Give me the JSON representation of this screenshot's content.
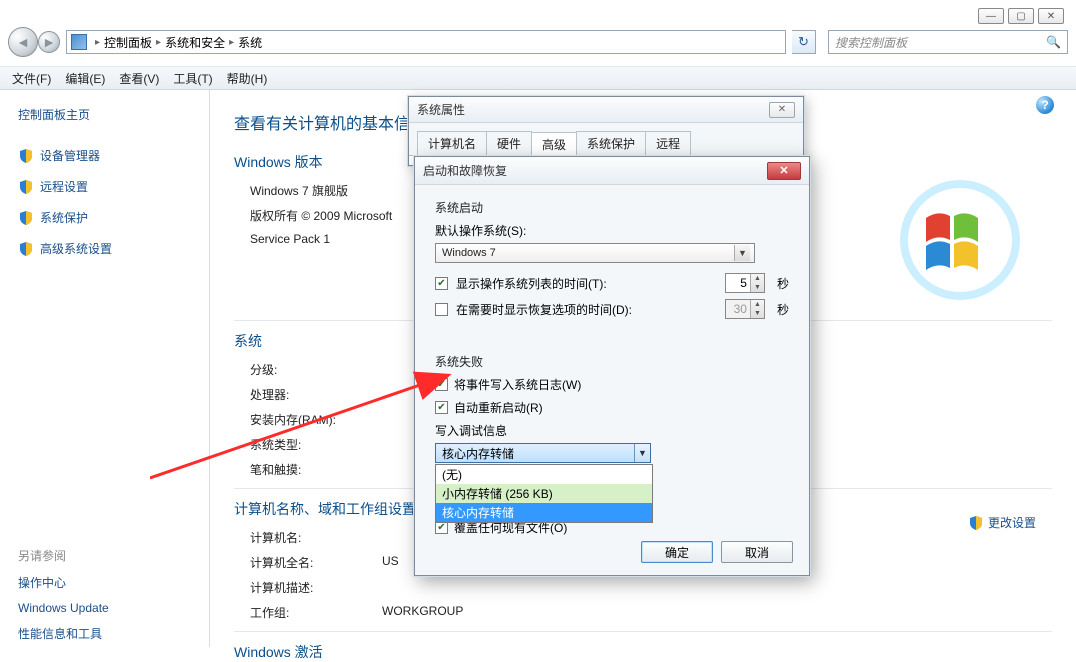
{
  "window_controls": {
    "min": "—",
    "max": "▢",
    "close": "✕"
  },
  "breadcrumb": {
    "seg1": "控制面板",
    "seg2": "系统和安全",
    "seg3": "系统"
  },
  "search_placeholder": "搜索控制面板",
  "menubar": {
    "file": "文件(F)",
    "edit": "编辑(E)",
    "view": "查看(V)",
    "tools": "工具(T)",
    "help": "帮助(H)"
  },
  "sidebar": {
    "home": "控制面板主页",
    "items": [
      {
        "label": "设备管理器"
      },
      {
        "label": "远程设置"
      },
      {
        "label": "系统保护"
      },
      {
        "label": "高级系统设置"
      }
    ],
    "seealso_title": "另请参阅",
    "seealso": [
      {
        "label": "操作中心"
      },
      {
        "label": "Windows Update"
      },
      {
        "label": "性能信息和工具"
      }
    ]
  },
  "main": {
    "heading": "查看有关计算机的基本信息",
    "winver_title": "Windows 版本",
    "edition": "Windows 7 旗舰版",
    "copyright": "版权所有 © 2009 Microsoft",
    "sp": "Service Pack 1",
    "system_title": "系统",
    "rating_k": "分级:",
    "cpu_k": "处理器:",
    "ram_k": "安装内存(RAM):",
    "systype_k": "系统类型:",
    "pen_k": "笔和触摸:",
    "cndw_title": "计算机名称、域和工作组设置",
    "cname_k": "计算机名:",
    "cfull_k": "计算机全名:",
    "cfull_v": "US",
    "cdesc_k": "计算机描述:",
    "wg_k": "工作组:",
    "wg_v": "WORKGROUP",
    "activation_title": "Windows 激活",
    "change_settings": "更改设置"
  },
  "sysprops": {
    "title": "系统属性",
    "tabs": {
      "name": "计算机名",
      "hw": "硬件",
      "adv": "高级",
      "protect": "系统保护",
      "remote": "远程"
    }
  },
  "startrec": {
    "title": "启动和故障恢复",
    "grp1": "系统启动",
    "default_os_label": "默认操作系统(S):",
    "default_os_value": "Windows 7",
    "chk_showlist": "显示操作系统列表的时间(T):",
    "chk_showrecov": "在需要时显示恢复选项的时间(D):",
    "time1": "5",
    "time2": "30",
    "sec": "秒",
    "grp2": "系统失败",
    "chk_eventlog": "将事件写入系统日志(W)",
    "chk_autoreboot": "自动重新启动(R)",
    "dump_label": "写入调试信息",
    "dump_selected": "核心内存转储",
    "dump_options": {
      "o0": "(无)",
      "o1": "小内存转储 (256 KB)",
      "o2": "核心内存转储"
    },
    "chk_overwrite": "覆盖任何现有文件(O)",
    "ok": "确定",
    "cancel": "取消"
  }
}
